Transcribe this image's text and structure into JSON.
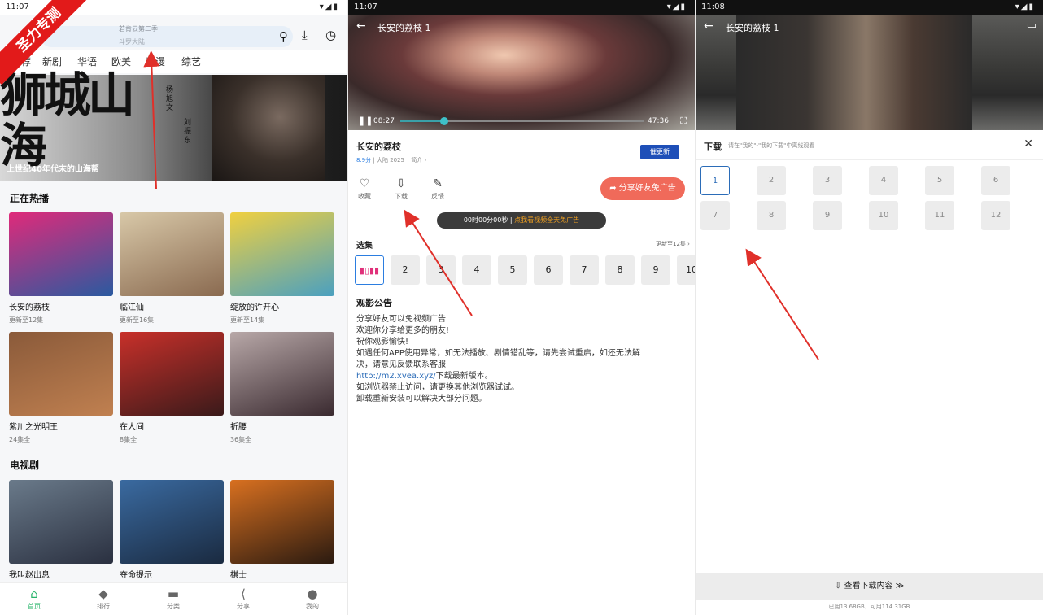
{
  "status_bar": {
    "time1": "11:07",
    "time2": "11:07",
    "time3": "11:08",
    "icons": "▾◢▮"
  },
  "watermark": "圣力专测",
  "home": {
    "search_hint_top": "若肯云第二季",
    "search_hint_bottom": "斗罗大陆",
    "tabs": [
      "推荐",
      "新剧",
      "华语",
      "欧美",
      "动漫",
      "综艺"
    ],
    "banner": {
      "title": "狮城山海",
      "cast1": "杨旭文",
      "cast2": "刘振东",
      "caption": "上世纪40年代末的山海帮"
    },
    "section_hot": "正在热播",
    "hot": [
      {
        "title": "长安的荔枝",
        "sub": "更新至12集",
        "c1": "#e02a7a",
        "c2": "#2a5aa0"
      },
      {
        "title": "临江仙",
        "sub": "更新至16集",
        "c1": "#d8c8a8",
        "c2": "#8a6a50"
      },
      {
        "title": "绽放的许开心",
        "sub": "更新至14集",
        "c1": "#f0d040",
        "c2": "#4aa0c0"
      },
      {
        "title": "紫川之光明王",
        "sub": "24集全",
        "c1": "#8a5a3a",
        "c2": "#c08050"
      },
      {
        "title": "在人间",
        "sub": "8集全",
        "c1": "#c8302a",
        "c2": "#3a1a1a"
      },
      {
        "title": "折腰",
        "sub": "36集全",
        "c1": "#b8a8a8",
        "c2": "#3a2a30"
      }
    ],
    "section_tv": "电视剧",
    "tv": [
      {
        "title": "我叫赵出息",
        "c1": "#6a7a8a",
        "c2": "#2a3040"
      },
      {
        "title": "夺命提示",
        "c1": "#3a6aa0",
        "c2": "#1a2a40"
      },
      {
        "title": "棋士",
        "c1": "#d87020",
        "c2": "#2a1a10"
      }
    ],
    "nav": [
      {
        "label": "首页",
        "icon": "⌂",
        "on": true
      },
      {
        "label": "排行",
        "icon": "◆",
        "on": false
      },
      {
        "label": "分类",
        "icon": "▬",
        "on": false
      },
      {
        "label": "分享",
        "icon": "⟨",
        "on": false
      },
      {
        "label": "我的",
        "icon": "●",
        "on": false
      }
    ]
  },
  "detail": {
    "video_title": "长安的荔枝 1",
    "time_current": "08:27",
    "time_total": "47:36",
    "progress": 0.18,
    "title": "长安的荔枝",
    "score": "8.9分",
    "meta": "大陆 2025",
    "intro": "简介 ›",
    "update_btn": "催更新",
    "actions": [
      {
        "label": "收藏",
        "icon": "♡"
      },
      {
        "label": "下载",
        "icon": "⇩"
      },
      {
        "label": "反馈",
        "icon": "✎"
      }
    ],
    "share_btn": "分享好友免广告",
    "share_icon": "➦",
    "timer_text": "00时00分00秒",
    "timer_sep": "|",
    "timer_link": "点我看视频全天免广告",
    "episodes_title": "选集",
    "episodes_more": "更新至12集 ›",
    "episodes": [
      "2",
      "3",
      "4",
      "5",
      "6",
      "7",
      "8",
      "9",
      "10"
    ],
    "notice_title": "观影公告",
    "notice_lines": [
      "分享好友可以免视频广告",
      "欢迎你分享给更多的朋友!",
      "祝你观影愉快!",
      "如遇任何APP使用异常，如无法播放、剧情错乱等，请先尝试重启，如还无法解",
      "决，请意见反馈联系客服"
    ],
    "notice_url": "http://m2.xvea.xyz/",
    "notice_url_tail": "下载最新版本。",
    "notice_tail": [
      "如浏览器禁止访问，请更换其他浏览器试试。",
      "卸载重新安装可以解决大部分问题。"
    ]
  },
  "download": {
    "video_title": "长安的荔枝 1",
    "title": "下载",
    "hint": "请在\"我的\"-\"我的下载\"中离线观看",
    "close": "✕",
    "episodes": [
      "1",
      "2",
      "3",
      "4",
      "5",
      "6",
      "7",
      "8",
      "9",
      "10",
      "11",
      "12"
    ],
    "view_btn": "查看下载内容 ≫",
    "view_icon": "⇩",
    "storage": "已用13.68GB，可用114.31GB"
  }
}
